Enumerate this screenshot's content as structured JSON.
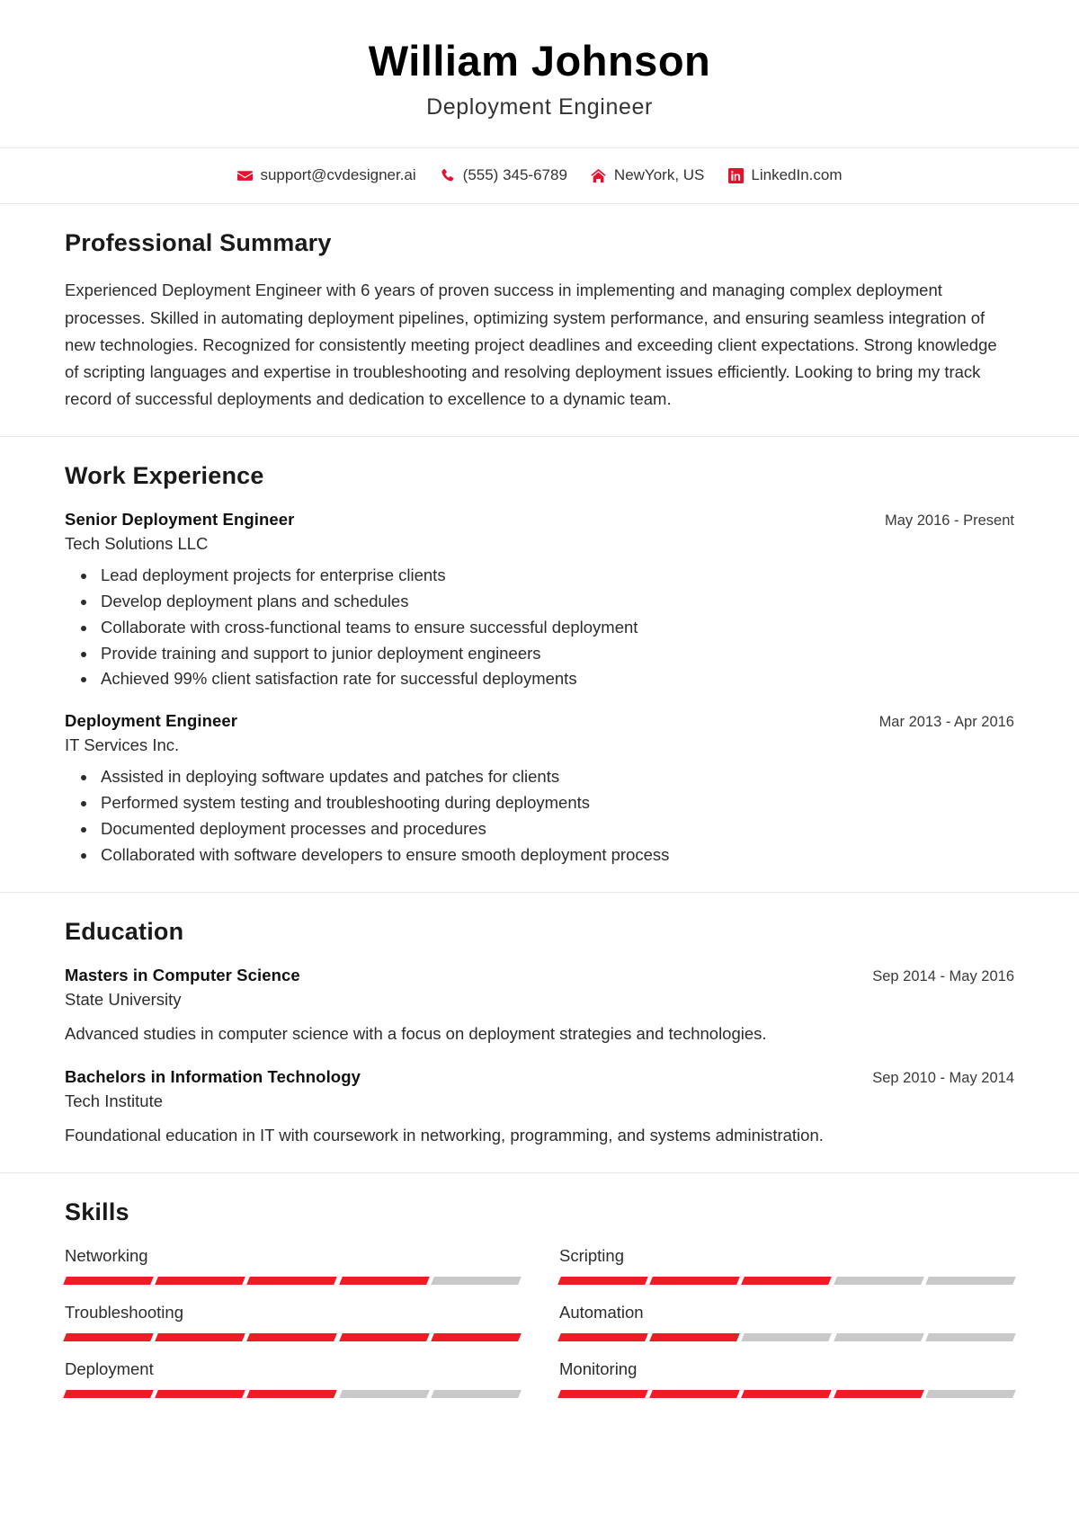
{
  "header": {
    "name": "William Johnson",
    "job_title": "Deployment Engineer"
  },
  "contact": {
    "items": [
      {
        "icon": "envelope-icon",
        "label": "support@cvdesigner.ai"
      },
      {
        "icon": "phone-icon",
        "label": "(555) 345-6789"
      },
      {
        "icon": "home-icon",
        "label": "NewYork, US"
      },
      {
        "icon": "linkedin-icon",
        "label": "LinkedIn.com"
      }
    ]
  },
  "summary": {
    "title": "Professional Summary",
    "text": "Experienced Deployment Engineer with 6 years of proven success in implementing and managing complex deployment processes. Skilled in automating deployment pipelines, optimizing system performance, and ensuring seamless integration of new technologies. Recognized for consistently meeting project deadlines and exceeding client expectations. Strong knowledge of scripting languages and expertise in troubleshooting and resolving deployment issues efficiently. Looking to bring my track record of successful deployments and dedication to excellence to a dynamic team."
  },
  "work": {
    "title": "Work Experience",
    "entries": [
      {
        "role": "Senior Deployment Engineer",
        "org": "Tech Solutions LLC",
        "date": "May 2016 - Present",
        "bullets": [
          "Lead deployment projects for enterprise clients",
          "Develop deployment plans and schedules",
          "Collaborate with cross-functional teams to ensure successful deployment",
          "Provide training and support to junior deployment engineers",
          "Achieved 99% client satisfaction rate for successful deployments"
        ]
      },
      {
        "role": "Deployment Engineer",
        "org": "IT Services Inc.",
        "date": "Mar 2013 - Apr 2016",
        "bullets": [
          "Assisted in deploying software updates and patches for clients",
          "Performed system testing and troubleshooting during deployments",
          "Documented deployment processes and procedures",
          "Collaborated with software developers to ensure smooth deployment process"
        ]
      }
    ]
  },
  "education": {
    "title": "Education",
    "entries": [
      {
        "degree": "Masters in Computer Science",
        "school": "State University",
        "date": "Sep 2014 - May 2016",
        "description": "Advanced studies in computer science with a focus on deployment strategies and technologies."
      },
      {
        "degree": "Bachelors in Information Technology",
        "school": "Tech Institute",
        "date": "Sep 2010 - May 2014",
        "description": "Foundational education in IT with coursework in networking, programming, and systems administration."
      }
    ]
  },
  "skills": {
    "title": "Skills",
    "max_level": 5,
    "items": [
      {
        "name": "Networking",
        "level": 4
      },
      {
        "name": "Scripting",
        "level": 3
      },
      {
        "name": "Troubleshooting",
        "level": 5
      },
      {
        "name": "Automation",
        "level": 2
      },
      {
        "name": "Deployment",
        "level": 3
      },
      {
        "name": "Monitoring",
        "level": 4
      }
    ]
  },
  "colors": {
    "accent": "#ee1c25",
    "inactive": "#c9c9c9",
    "text": "#2c2c2c",
    "divider": "#e9e9e9"
  }
}
